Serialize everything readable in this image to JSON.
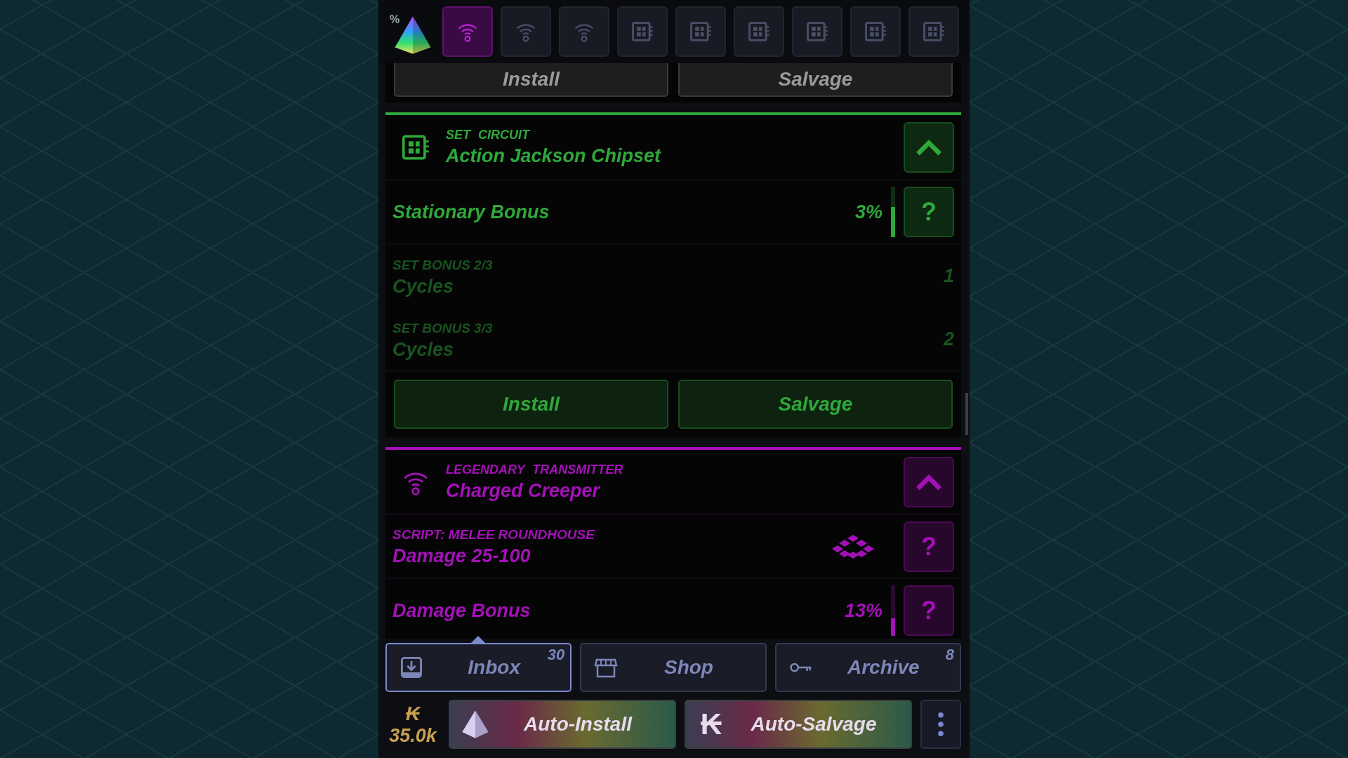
{
  "logo": {
    "badge": "%"
  },
  "tabs": [
    {
      "kind": "transmitter",
      "selected": true
    },
    {
      "kind": "transmitter",
      "selected": false
    },
    {
      "kind": "transmitter",
      "selected": false
    },
    {
      "kind": "circuit",
      "selected": false
    },
    {
      "kind": "circuit",
      "selected": false
    },
    {
      "kind": "circuit",
      "selected": false
    },
    {
      "kind": "circuit",
      "selected": false
    },
    {
      "kind": "circuit",
      "selected": false
    },
    {
      "kind": "circuit",
      "selected": false
    }
  ],
  "cards": [
    {
      "color": "#8c8c8c",
      "buttons": [
        "Install",
        "Salvage"
      ]
    },
    {
      "color": "#2fa83a",
      "kind": "circuit",
      "rarity": "SET CIRCUIT",
      "title": "Action Jackson Chipset",
      "expanded": true,
      "rows": [
        {
          "kind": "stat",
          "name": "Stationary Bonus",
          "value": "3%",
          "level": 0.6,
          "help": "?"
        },
        {
          "kind": "set_bonus",
          "label": "SET BONUS 2/3",
          "name": "Cycles",
          "value": "1",
          "active": false
        },
        {
          "kind": "set_bonus",
          "label": "SET BONUS 3/3",
          "name": "Cycles",
          "value": "2",
          "active": false
        }
      ],
      "buttons": [
        "Install",
        "Salvage"
      ]
    },
    {
      "color": "#a410b8",
      "kind": "transmitter",
      "rarity": "LEGENDARY TRANSMITTER",
      "title": "Charged Creeper",
      "expanded": true,
      "rows": [
        {
          "kind": "script",
          "label": "SCRIPT: MELEE ROUNDHOUSE",
          "name": "Damage 25-100",
          "help": "?"
        },
        {
          "kind": "stat",
          "name": "Damage Bonus",
          "value": "13%",
          "level": 0.35,
          "help": "?"
        }
      ]
    }
  ],
  "nav": [
    {
      "kind": "inbox",
      "label": "Inbox",
      "count": "30",
      "selected": true
    },
    {
      "kind": "shop",
      "label": "Shop",
      "selected": false
    },
    {
      "kind": "archive",
      "label": "Archive",
      "count": "8",
      "selected": false
    }
  ],
  "currency": {
    "symbol": "₭",
    "amount": "35.0k"
  },
  "actions": [
    {
      "kind": "install",
      "label": "Auto-Install"
    },
    {
      "kind": "salvage",
      "label": "Auto-Salvage",
      "glyph": "₭"
    }
  ]
}
